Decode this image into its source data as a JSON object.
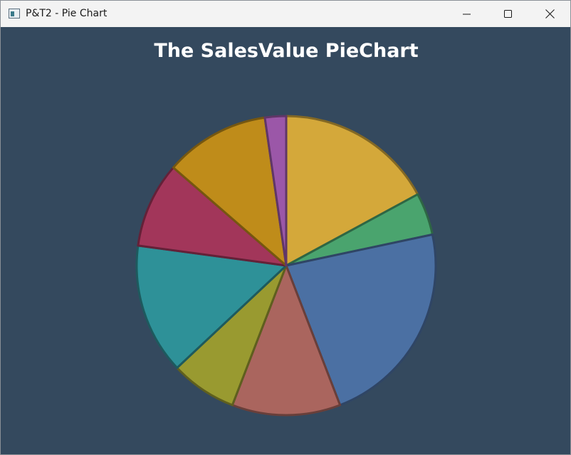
{
  "window": {
    "title": "P&T2 - Pie Chart",
    "icon": "app-window-icon",
    "controls": [
      "minimize-icon",
      "maximize-icon",
      "close-icon"
    ],
    "background": "#34495e"
  },
  "chart_data": {
    "type": "pie",
    "title": "The SalesValue PieChart",
    "start_angle_deg": 0,
    "direction": "clockwise",
    "legend": "none",
    "slices": [
      {
        "value": 17.2,
        "color": "#d4a83a"
      },
      {
        "value": 4.6,
        "color": "#4aa46e"
      },
      {
        "value": 22.6,
        "color": "#4b70a3"
      },
      {
        "value": 11.8,
        "color": "#aa655e"
      },
      {
        "value": 7.2,
        "color": "#999a30"
      },
      {
        "value": 14.2,
        "color": "#2e9198"
      },
      {
        "value": 9.3,
        "color": "#a2365a"
      },
      {
        "value": 11.4,
        "color": "#bf8c1a"
      },
      {
        "value": 2.3,
        "color": "#9b57a8"
      }
    ]
  }
}
